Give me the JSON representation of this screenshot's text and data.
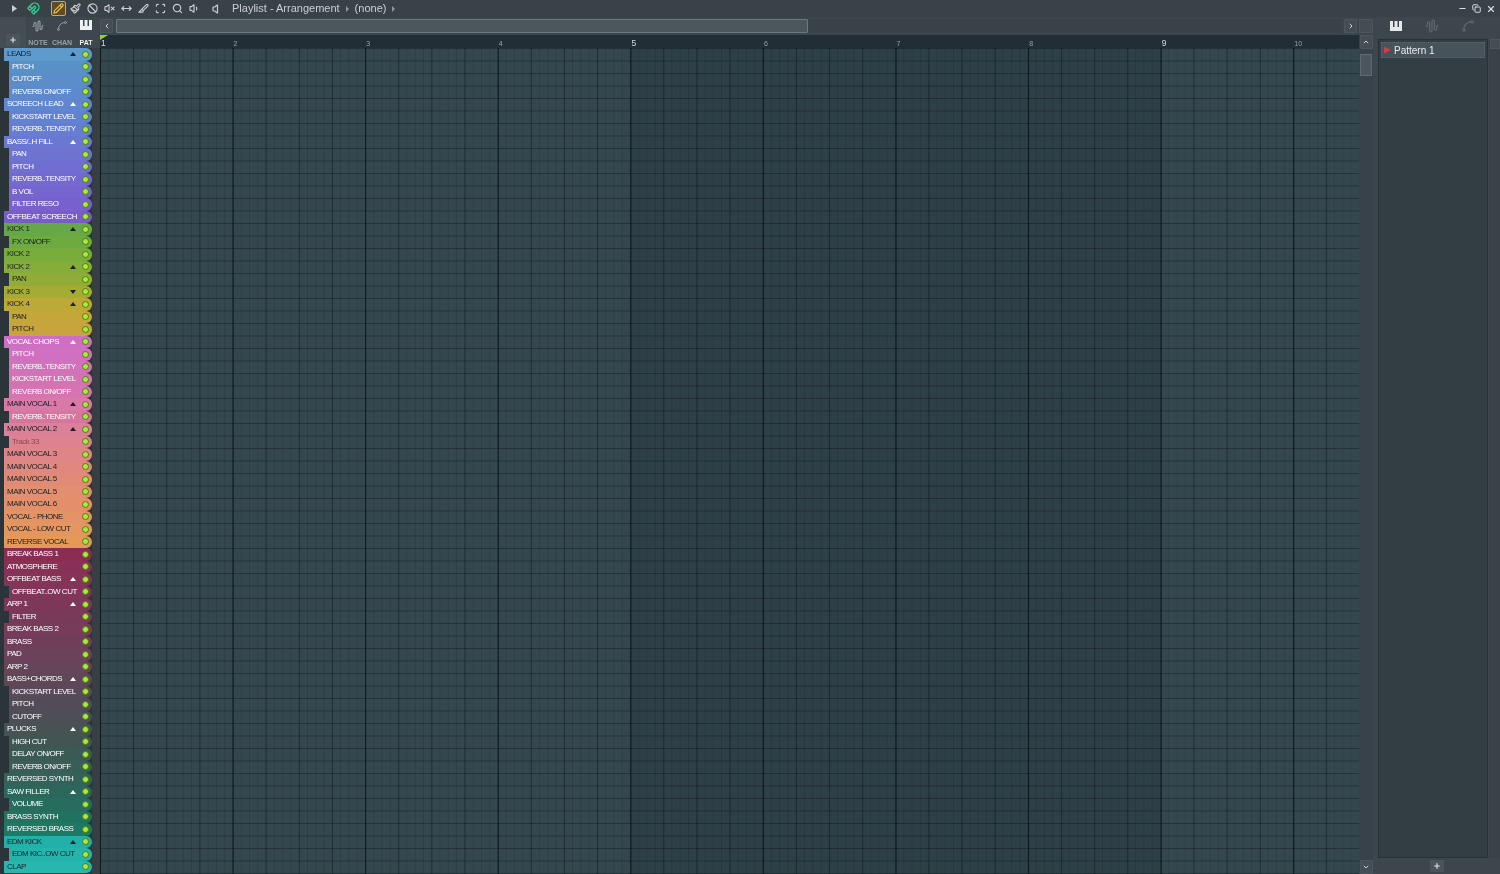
{
  "window": {
    "title": "Playlist - Arrangement",
    "pattern": "(none)"
  },
  "snap": {
    "on": true
  },
  "tools": [
    {
      "kind": "draw",
      "selected": true
    },
    {
      "kind": "paint",
      "selected": false
    },
    {
      "kind": "delete",
      "selected": false
    },
    {
      "kind": "mute",
      "selected": false
    },
    {
      "kind": "slip",
      "selected": false
    },
    {
      "kind": "slice",
      "selected": false
    },
    {
      "kind": "select",
      "selected": false
    },
    {
      "kind": "zoom",
      "selected": false
    },
    {
      "kind": "playback",
      "selected": false
    }
  ],
  "filters": [
    {
      "label": "NOTE",
      "kind": "audio",
      "selected": false
    },
    {
      "label": "CHAN",
      "kind": "automation",
      "selected": false
    },
    {
      "label": "PAT",
      "kind": "pattern",
      "selected": true
    }
  ],
  "ruler": {
    "bars": [
      "1",
      "2",
      "3",
      "4",
      "5",
      "6",
      "7",
      "8",
      "9",
      "10"
    ]
  },
  "tracks": [
    {
      "name": "LEADS",
      "kind": "group",
      "expanded": true,
      "color": "#5e9acc",
      "enabled": true,
      "dimmed": false,
      "children": [
        {
          "name": "PITCH",
          "color": "#5890c8",
          "enabled": true,
          "dimmed": false
        },
        {
          "name": "CUTOFF",
          "color": "#5a8dca",
          "enabled": true,
          "dimmed": false
        },
        {
          "name": "REVERB ON/OFF",
          "color": "#5c8acc",
          "enabled": true,
          "dimmed": false
        }
      ]
    },
    {
      "name": "SCREECH LEAD",
      "kind": "group",
      "expanded": true,
      "color": "#5f86cf",
      "enabled": true,
      "dimmed": false,
      "children": [
        {
          "name": "KICKSTART LEVEL",
          "color": "#6282d1",
          "enabled": true,
          "dimmed": false
        },
        {
          "name": "REVERB..TENSITY",
          "color": "#657ed2",
          "enabled": true,
          "dimmed": false
        }
      ]
    },
    {
      "name": "BASS/..H FILL",
      "kind": "group",
      "expanded": true,
      "color": "#6a78d3",
      "enabled": true,
      "dimmed": false,
      "children": [
        {
          "name": "PAN",
          "color": "#6e73d2",
          "enabled": true,
          "dimmed": false
        },
        {
          "name": "PITCH",
          "color": "#716ed2",
          "enabled": true,
          "dimmed": false
        },
        {
          "name": "REVERB..TENSITY",
          "color": "#7469d0",
          "enabled": true,
          "dimmed": false
        },
        {
          "name": "B VOL",
          "color": "#7665ce",
          "enabled": true,
          "dimmed": false
        },
        {
          "name": "FILTER RESO",
          "color": "#7861cc",
          "enabled": true,
          "dimmed": false
        }
      ]
    },
    {
      "name": "OFFBEAT SCREECH",
      "kind": "track",
      "color": "#7a5cc8",
      "enabled": true,
      "dimmed": false
    },
    {
      "name": "KICK 1",
      "kind": "group",
      "expanded": true,
      "color": "#66a845",
      "enabled": true,
      "dimmed": false,
      "children": [
        {
          "name": "FX ON/OFF",
          "color": "#6daa42",
          "enabled": true,
          "dimmed": false
        }
      ]
    },
    {
      "name": "KICK 2",
      "kind": "track",
      "color": "#78ad3e",
      "enabled": true,
      "dimmed": false
    },
    {
      "name": "KICK 2",
      "kind": "group",
      "expanded": true,
      "color": "#86ad3a",
      "enabled": true,
      "dimmed": false,
      "children": [
        {
          "name": "PAN",
          "color": "#92ad37",
          "enabled": true,
          "dimmed": false
        }
      ]
    },
    {
      "name": "KICK 3",
      "kind": "group",
      "expanded": false,
      "color": "#a4ac34",
      "enabled": true,
      "dimmed": false
    },
    {
      "name": "KICK 4",
      "kind": "group",
      "expanded": true,
      "color": "#bca938",
      "enabled": true,
      "dimmed": false,
      "children": [
        {
          "name": "PAN",
          "color": "#c4a63a",
          "enabled": true,
          "dimmed": false
        },
        {
          "name": "PITCH",
          "color": "#c9a33c",
          "enabled": true,
          "dimmed": false
        }
      ]
    },
    {
      "name": "VOCAL CHOPS",
      "kind": "group",
      "expanded": true,
      "color": "#cf6fc4",
      "enabled": true,
      "dimmed": false,
      "children": [
        {
          "name": "PITCH",
          "color": "#d070c0",
          "enabled": true,
          "dimmed": false
        },
        {
          "name": "REVERB..TENSITY",
          "color": "#d272bb",
          "enabled": true,
          "dimmed": false
        },
        {
          "name": "KICKSTART LEVEL",
          "color": "#d373b3",
          "enabled": true,
          "dimmed": false
        },
        {
          "name": "REVERB ON/OFF",
          "color": "#d574b0",
          "enabled": true,
          "dimmed": false
        }
      ]
    },
    {
      "name": "MAIN VOCAL 1",
      "kind": "group",
      "expanded": true,
      "color": "#d879a8",
      "enabled": true,
      "dimmed": false,
      "children": [
        {
          "name": "REVERB..TENSITY",
          "color": "#d6769f",
          "enabled": true,
          "dimmed": false
        }
      ]
    },
    {
      "name": "MAIN VOCAL 2",
      "kind": "group",
      "expanded": true,
      "color": "#dc7f98",
      "enabled": true,
      "dimmed": false,
      "children": [
        {
          "name": "Track 33",
          "color": "#de8290",
          "enabled": true,
          "dimmed": true
        }
      ]
    },
    {
      "name": "MAIN VOCAL 3",
      "kind": "track",
      "color": "#df8587",
      "enabled": true,
      "dimmed": false
    },
    {
      "name": "MAIN VOCAL 4",
      "kind": "track",
      "color": "#e0887f",
      "enabled": true,
      "dimmed": false
    },
    {
      "name": "MAIN VOCAL 5",
      "kind": "track",
      "color": "#e18b77",
      "enabled": true,
      "dimmed": false
    },
    {
      "name": "MAIN VOCAL 5",
      "kind": "track",
      "color": "#e28e70",
      "enabled": true,
      "dimmed": false
    },
    {
      "name": "MAIN VOCAL 6",
      "kind": "track",
      "color": "#e3906a",
      "enabled": true,
      "dimmed": false
    },
    {
      "name": "VOCAL - PHONE",
      "kind": "track",
      "color": "#e39364",
      "enabled": true,
      "dimmed": false
    },
    {
      "name": "VOCAL - LOW CUT",
      "kind": "track",
      "color": "#e4965e",
      "enabled": true,
      "dimmed": false
    },
    {
      "name": "REVERSE VOCAL",
      "kind": "track",
      "color": "#e49958",
      "enabled": true,
      "dimmed": false
    },
    {
      "name": "BREAK BASS 1",
      "kind": "track",
      "color": "#8b2d52",
      "enabled": true,
      "dimmed": false
    },
    {
      "name": "ATMOSPHERE",
      "kind": "track",
      "color": "#883055",
      "enabled": true,
      "dimmed": false
    },
    {
      "name": "OFFBEAT BASS",
      "kind": "group",
      "expanded": true,
      "color": "#853357",
      "enabled": true,
      "dimmed": false,
      "children": [
        {
          "name": "OFFBEAT..OW CUT",
          "color": "#813558",
          "enabled": true,
          "dimmed": false
        }
      ]
    },
    {
      "name": "ARP 1",
      "kind": "group",
      "expanded": true,
      "color": "#7d3859",
      "enabled": true,
      "dimmed": false,
      "children": [
        {
          "name": "FILTER",
          "color": "#793a5a",
          "enabled": true,
          "dimmed": false
        }
      ]
    },
    {
      "name": "BREAK BASS 2",
      "kind": "track",
      "color": "#763c5a",
      "enabled": true,
      "dimmed": false
    },
    {
      "name": "BRASS",
      "kind": "track",
      "color": "#713e5a",
      "enabled": true,
      "dimmed": false
    },
    {
      "name": "PAD",
      "kind": "track",
      "color": "#6c415a",
      "enabled": true,
      "dimmed": false
    },
    {
      "name": "ARP 2",
      "kind": "track",
      "color": "#664459",
      "enabled": true,
      "dimmed": false
    },
    {
      "name": "BASS+CHORDS",
      "kind": "group",
      "expanded": true,
      "color": "#5f4758",
      "enabled": true,
      "dimmed": false,
      "children": [
        {
          "name": "KICKSTART LEVEL",
          "color": "#584a58",
          "enabled": true,
          "dimmed": false
        },
        {
          "name": "PITCH",
          "color": "#524c57",
          "enabled": true,
          "dimmed": false
        },
        {
          "name": "CUTOFF",
          "color": "#4c4f56",
          "enabled": true,
          "dimmed": false
        }
      ]
    },
    {
      "name": "PLUCKS",
      "kind": "group",
      "expanded": true,
      "color": "#465254",
      "enabled": true,
      "dimmed": false,
      "children": [
        {
          "name": "HIGH CUT",
          "color": "#415653",
          "enabled": true,
          "dimmed": false
        },
        {
          "name": "DELAY ON/OFF",
          "color": "#3c5a55",
          "enabled": true,
          "dimmed": false
        },
        {
          "name": "REVERB ON/OFF",
          "color": "#375e57",
          "enabled": true,
          "dimmed": false
        }
      ]
    },
    {
      "name": "REVERSED SYNTH",
      "kind": "track",
      "color": "#32625a",
      "enabled": true,
      "dimmed": false
    },
    {
      "name": "SAW FILLER",
      "kind": "group",
      "expanded": true,
      "color": "#2c675c",
      "enabled": true,
      "dimmed": false,
      "children": [
        {
          "name": "VOLUME",
          "color": "#276c5e",
          "enabled": true,
          "dimmed": false
        }
      ]
    },
    {
      "name": "BRASS SYNTH",
      "kind": "track",
      "color": "#227260",
      "enabled": true,
      "dimmed": false
    },
    {
      "name": "REVERSED BRASS",
      "kind": "track",
      "color": "#1d7864",
      "enabled": true,
      "dimmed": false
    },
    {
      "name": "EDM KICK",
      "kind": "group",
      "expanded": true,
      "color": "#22b0a8",
      "enabled": true,
      "dimmed": false,
      "children": [
        {
          "name": "EDM KIC..OW CUT",
          "color": "#24b4ac",
          "enabled": true,
          "dimmed": false
        }
      ]
    },
    {
      "name": "CLAP",
      "kind": "track",
      "color": "#26b8b0",
      "enabled": true,
      "dimmed": false
    }
  ],
  "picker": {
    "tabs": [
      {
        "kind": "pattern",
        "selected": true
      },
      {
        "kind": "audio",
        "selected": false
      },
      {
        "kind": "automation",
        "selected": false
      }
    ],
    "items": [
      {
        "name": "Pattern 1",
        "selected": true
      }
    ]
  }
}
